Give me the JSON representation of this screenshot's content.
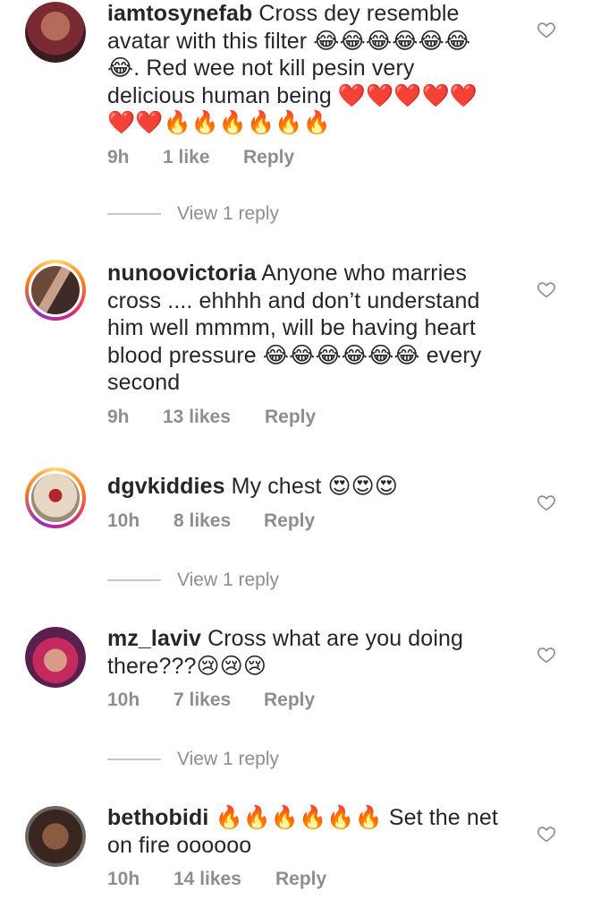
{
  "comments": [
    {
      "username": "iamtosynefab",
      "text": "Cross dey resemble avatar with this filter 😂😂😂😂😂😂😂. Red wee not kill pesin very delicious human being ❤️❤️❤️❤️❤️❤️❤️🔥🔥🔥🔥🔥🔥",
      "time": "9h",
      "likes": "1 like",
      "reply": "Reply",
      "view_reply": "View 1 reply"
    },
    {
      "username": "nunoovictoria",
      "text": "Anyone who marries cross .... ehhhh and don’t understand him well mmmm, will be having heart blood pressure 😂😂😂😂😂😂 every second",
      "time": "9h",
      "likes": "13 likes",
      "reply": "Reply"
    },
    {
      "username": "dgvkiddies",
      "text": "My chest 😍😍😍",
      "time": "10h",
      "likes": "8 likes",
      "reply": "Reply",
      "view_reply": "View 1 reply"
    },
    {
      "username": "mz_laviv",
      "text": "Cross what are you doing there???😢😢😢",
      "time": "10h",
      "likes": "7 likes",
      "reply": "Reply",
      "view_reply": "View 1 reply"
    },
    {
      "username": "bethobidi",
      "text": "🔥🔥🔥🔥🔥🔥 Set the net on fire oooooo",
      "time": "10h",
      "likes": "14 likes",
      "reply": "Reply"
    }
  ],
  "colors": {
    "meta_grey": "#8e8e8e",
    "text": "#262626",
    "story_ring": "#d62976"
  },
  "icons": {
    "like": "heart-outline-icon"
  }
}
